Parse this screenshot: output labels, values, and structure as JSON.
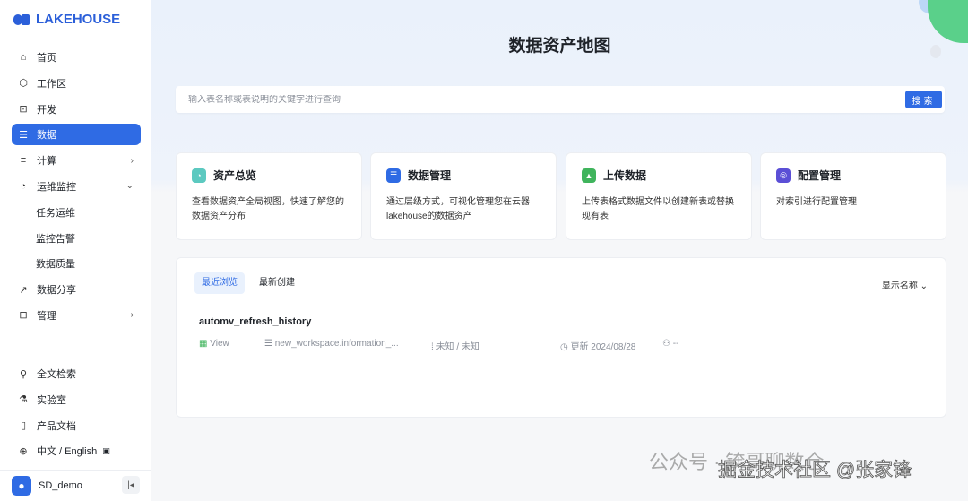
{
  "brand": "LAKEHOUSE",
  "nav": [
    {
      "label": "首页",
      "icon": "home-icon"
    },
    {
      "label": "工作区",
      "icon": "cube-icon"
    },
    {
      "label": "开发",
      "icon": "terminal-icon"
    },
    {
      "label": "数据",
      "icon": "database-icon",
      "active": true
    },
    {
      "label": "计算",
      "icon": "compute-icon"
    },
    {
      "label": "运维监控",
      "icon": "monitor-icon"
    },
    {
      "label": "任务运维"
    },
    {
      "label": "监控告警"
    },
    {
      "label": "数据质量"
    },
    {
      "label": "数据分享",
      "icon": "share-icon"
    },
    {
      "label": "管理",
      "icon": "manage-icon"
    }
  ],
  "bottom_nav": [
    {
      "label": "全文检索",
      "icon": "search-icon"
    },
    {
      "label": "实验室",
      "icon": "flask-icon"
    },
    {
      "label": "产品文档",
      "icon": "book-icon"
    },
    {
      "label": "中文 / English",
      "icon": "globe-icon"
    }
  ],
  "user": {
    "name": "SD_demo"
  },
  "page": {
    "title": "数据资产地图"
  },
  "search": {
    "placeholder": "输入表名称或表说明的关键字进行查询",
    "button": "搜索"
  },
  "cards": [
    {
      "title": "资产总览",
      "desc": "查看数据资产全局视图，快速了解您的数据资产分布",
      "color": "#5cc9c0"
    },
    {
      "title": "数据管理",
      "desc": "通过层级方式，可视化管理您在云器lakehouse的数据资产",
      "color": "#2f6be4"
    },
    {
      "title": "上传数据",
      "desc": "上传表格式数据文件以创建新表或替换现有表",
      "color": "#3fb45c"
    },
    {
      "title": "配置管理",
      "desc": "对索引进行配置管理",
      "color": "#5b4fd6"
    }
  ],
  "recent": {
    "tabs": [
      "最近浏览",
      "最新创建"
    ],
    "display": "显示名称",
    "item": {
      "name": "automv_refresh_history",
      "type": "View",
      "location": "new_workspace.information_...",
      "owner_info": "未知 / 未知",
      "updated": "更新 2024/08/28",
      "user": "--"
    }
  },
  "watermarks": [
    "公众号 · 锛哥聊数仓",
    "掘金技术社区 @张家锋"
  ]
}
